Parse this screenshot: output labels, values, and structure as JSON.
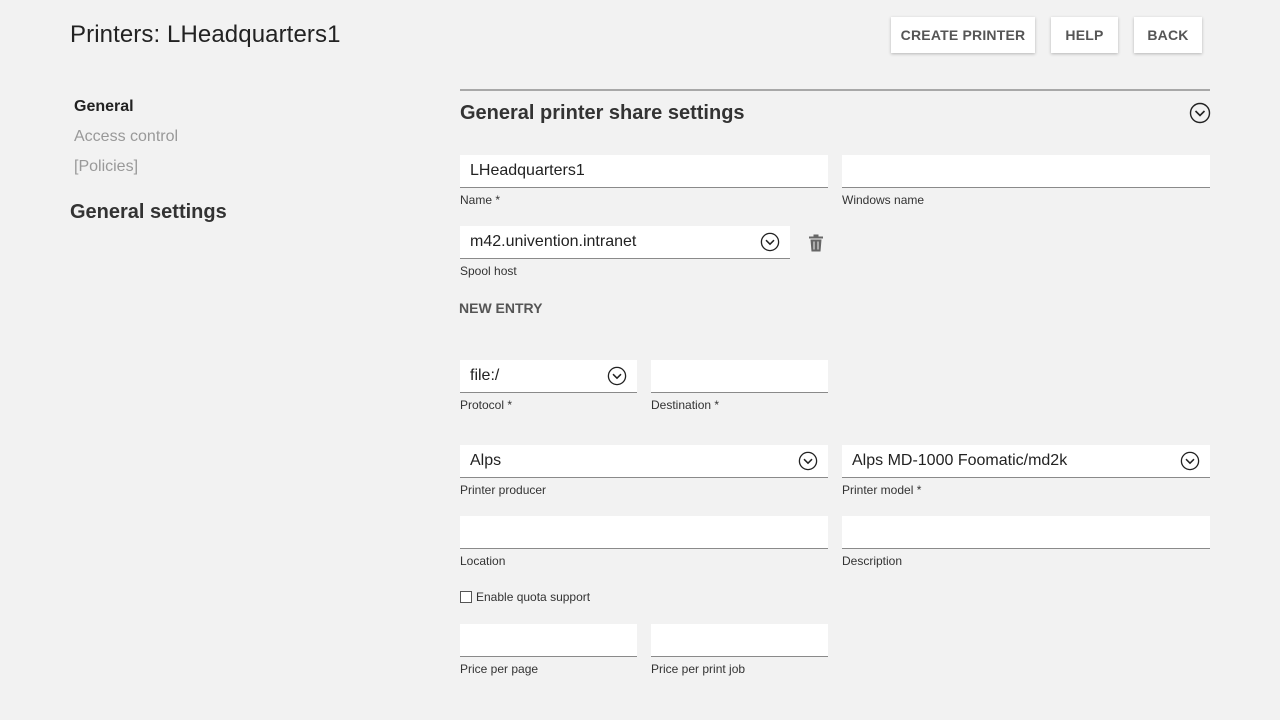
{
  "header": {
    "title": "Printers: LHeadquarters1",
    "buttons": {
      "create": "CREATE PRINTER",
      "help": "HELP",
      "back": "BACK"
    }
  },
  "sidebar": {
    "items": [
      {
        "label": "General",
        "active": true
      },
      {
        "label": "Access control",
        "active": false
      },
      {
        "label": "[Policies]",
        "active": false
      }
    ],
    "heading": "General settings"
  },
  "section": {
    "title": "General printer share settings",
    "collapse_icon": "chevron-down-circle-icon"
  },
  "form": {
    "name": {
      "value": "LHeadquarters1",
      "label": "Name *"
    },
    "windows_name": {
      "value": "",
      "label": "Windows name"
    },
    "spool_host": {
      "value": "m42.univention.intranet",
      "label": "Spool host",
      "delete_icon": "trash-icon"
    },
    "new_entry_label": "NEW ENTRY",
    "protocol": {
      "value": "file:/",
      "label": "Protocol *"
    },
    "destination": {
      "value": "",
      "label": "Destination *"
    },
    "printer_producer": {
      "value": "Alps",
      "label": "Printer producer"
    },
    "printer_model": {
      "value": "Alps MD-1000 Foomatic/md2k",
      "label": "Printer model *"
    },
    "location": {
      "value": "",
      "label": "Location"
    },
    "description": {
      "value": "",
      "label": "Description"
    },
    "quota": {
      "label": "Enable quota support",
      "checked": false
    },
    "price_per_page": {
      "value": "",
      "label": "Price per page"
    },
    "price_per_job": {
      "value": "",
      "label": "Price per print job"
    }
  },
  "colors": {
    "background": "#f2f2f2",
    "field_bg": "#ffffff",
    "text": "#222222",
    "muted": "#999999"
  }
}
